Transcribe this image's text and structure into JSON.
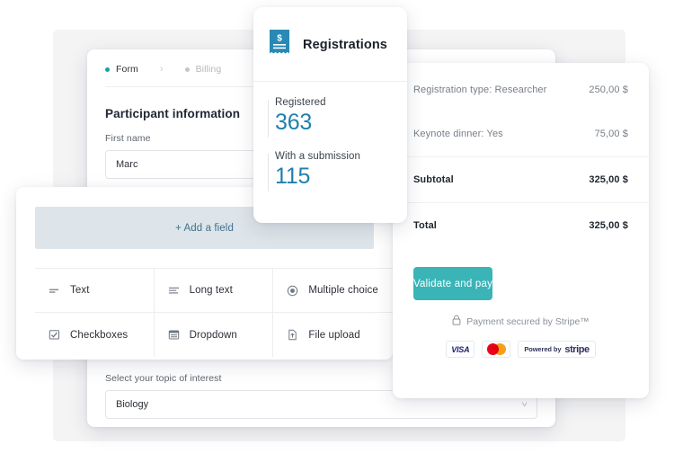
{
  "colors": {
    "teal_accent": "#3ab4b7",
    "blue_stat": "#1f7fad",
    "icon_blue": "#2889b5",
    "backdrop_gray": "#f4f4f5",
    "addfield_bg": "#dde5ea"
  },
  "form_card": {
    "breadcrumb": [
      {
        "label": "Form",
        "state": "active"
      },
      {
        "label": "Billing",
        "state": "inactive"
      }
    ],
    "separator": "›",
    "section_title": "Participant information",
    "first_name": {
      "label": "First name",
      "value": "Marc"
    },
    "topic": {
      "label": "Select your topic of interest",
      "value": "Biology",
      "chevron": "chevron-down"
    }
  },
  "registrations_card": {
    "icon": "receipt-dollar-icon",
    "title": "Registrations",
    "stats": [
      {
        "label": "Registered",
        "value": "363"
      },
      {
        "label": "With a submission",
        "value": "115"
      }
    ]
  },
  "builder_card": {
    "add_field_label": "+ Add a field",
    "field_types": [
      {
        "icon": "text-line-icon",
        "label": "Text"
      },
      {
        "icon": "long-text-icon",
        "label": "Long text"
      },
      {
        "icon": "radio-icon",
        "label": "Multiple choice"
      },
      {
        "icon": "checkbox-icon",
        "label": "Checkboxes"
      },
      {
        "icon": "dropdown-icon",
        "label": "Dropdown"
      },
      {
        "icon": "file-upload-icon",
        "label": "File upload"
      }
    ]
  },
  "payment_card": {
    "lines": [
      {
        "label": "Registration type: Researcher",
        "amount": "250,00 $"
      },
      {
        "label": "Keynote dinner: Yes",
        "amount": "75,00 $"
      }
    ],
    "subtotal": {
      "label": "Subtotal",
      "amount": "325,00 $"
    },
    "total": {
      "label": "Total",
      "amount": "325,00 $"
    },
    "pay_button": "Validate and pay",
    "secured_text": "Payment secured by Stripe™",
    "secured_icon": "lock-icon",
    "badges": {
      "visa": "VISA",
      "mastercard": "mastercard-logo",
      "stripe_prefix": "Powered by",
      "stripe_name": "stripe"
    }
  }
}
